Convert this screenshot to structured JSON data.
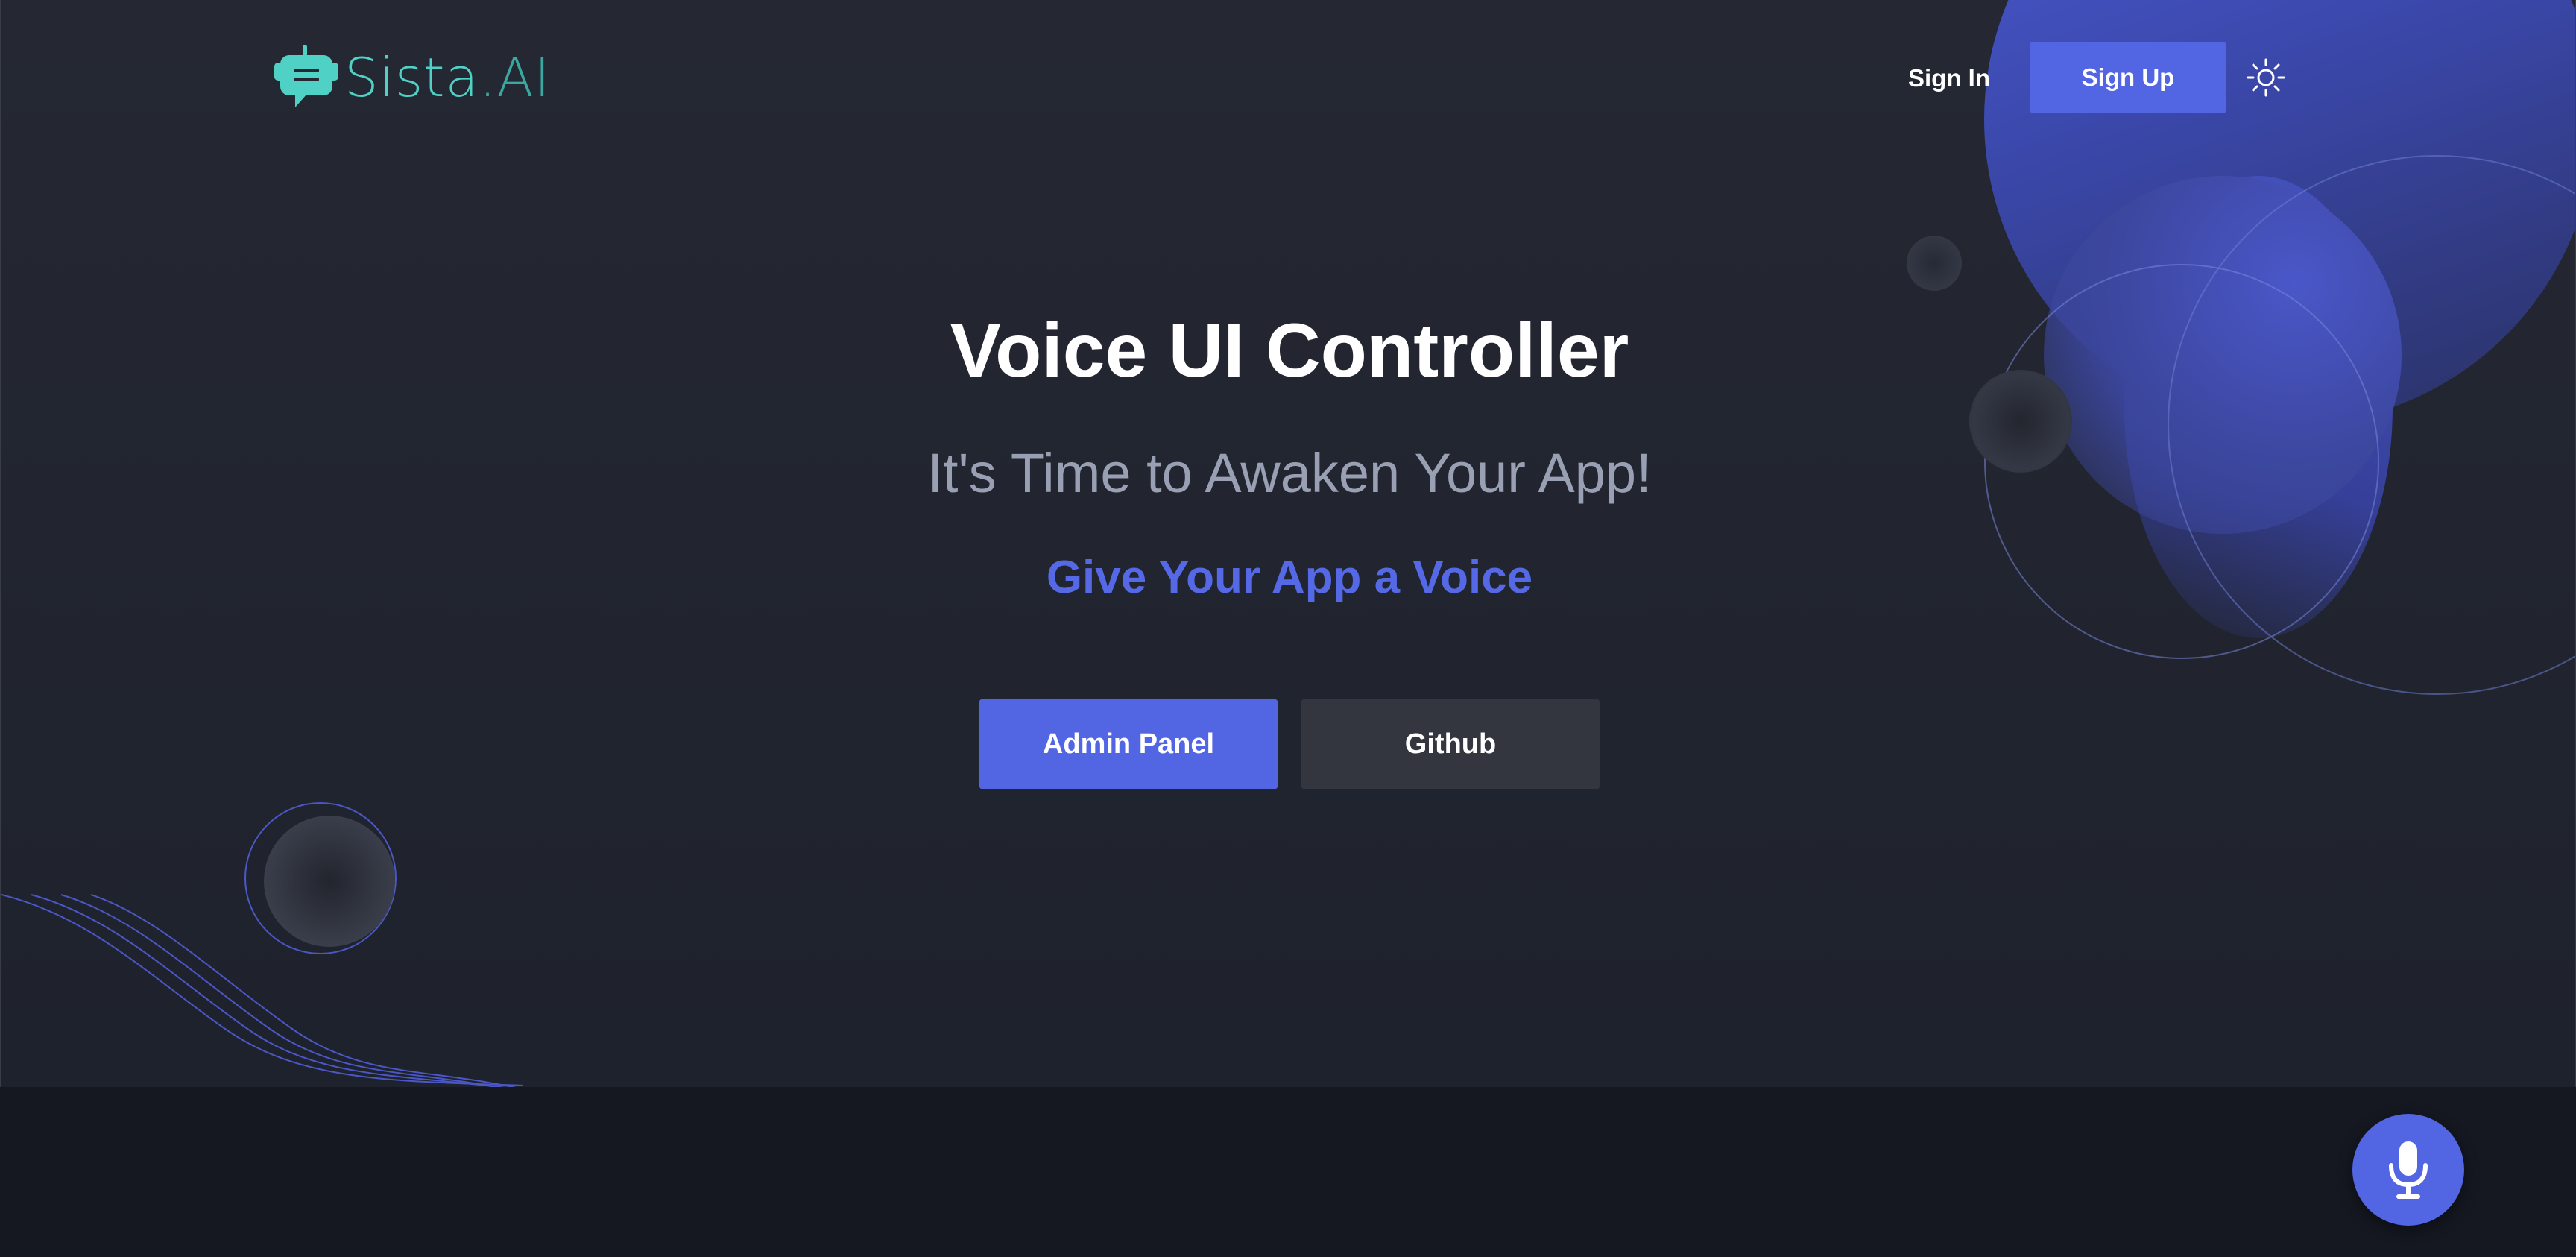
{
  "header": {
    "logo": {
      "name": "Sista",
      "suffix": ".AI",
      "icon": "chat-bot-icon"
    },
    "nav": {
      "sign_in_label": "Sign In",
      "sign_up_label": "Sign Up",
      "theme_toggle_icon": "sun-icon"
    }
  },
  "hero": {
    "title": "Voice UI Controller",
    "subtitle": "It's Time to Awaken Your App!",
    "tagline": "Give Your App a Voice",
    "buttons": {
      "primary_label": "Admin Panel",
      "secondary_label": "Github"
    }
  },
  "floating": {
    "mic_icon": "microphone-icon"
  },
  "colors": {
    "background": "#252832",
    "accent": "#5266e3",
    "logo": "#4fd1c5",
    "subtitle": "#9aa0b4",
    "secondary_button": "#33363f",
    "footer_band": "#151821"
  }
}
